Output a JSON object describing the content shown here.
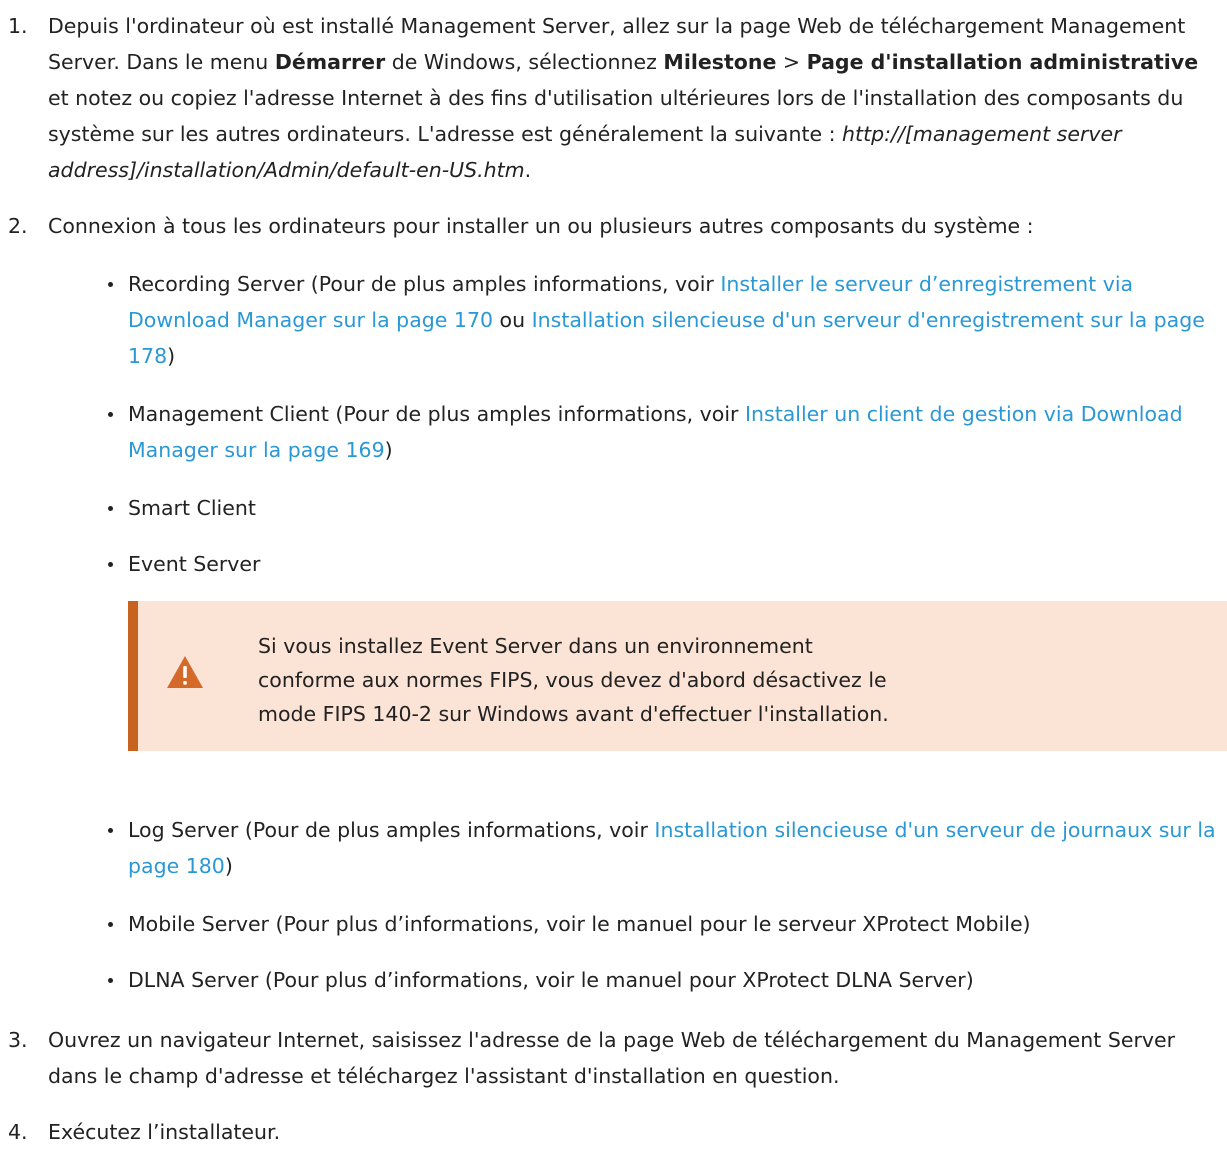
{
  "steps": [
    {
      "number": "1.",
      "text_a": "Depuis l'ordinateur où est installé Management Server, allez sur la page Web de téléchargement Management Server. Dans le menu ",
      "bold_a": "Démarrer",
      "text_b": " de Windows, sélectionnez ",
      "bold_b": "Milestone",
      "text_c": " > ",
      "bold_c": "Page d'installation administrative",
      "text_d": " et notez ou copiez l'adresse Internet à des fins d'utilisation ultérieures lors de l'installation des composants du système sur les autres ordinateurs. L'adresse est généralement la suivante : ",
      "italic": "http://[management server address]/installation/Admin/default-en-US.htm",
      "text_e": "."
    },
    {
      "number": "2.",
      "text": "Connexion à tous les ordinateurs pour installer un ou plusieurs autres composants du système :"
    },
    {
      "number": "3.",
      "text": "Ouvrez un navigateur Internet, saisissez l'adresse de la page Web de téléchargement du Management Server dans le champ d'adresse et téléchargez l'assistant d'installation en question."
    },
    {
      "number": "4.",
      "text": "Exécutez l’installateur."
    }
  ],
  "components": {
    "recording": {
      "text": "Recording Server (Pour de plus amples informations, voir ",
      "link1": "Installer le serveur d’enregistrement via Download Manager sur la page 170",
      "middle": " ou ",
      "link2": "Installation silencieuse d'un serveur d'enregistrement sur la page 178",
      "end": ")"
    },
    "management": {
      "text": "Management Client (Pour de plus amples informations, voir ",
      "link": "Installer un client de gestion via Download Manager sur la page 169",
      "end": ")"
    },
    "smart_client": "Smart Client",
    "event_server": "Event Server",
    "log_server": {
      "text": "Log Server (Pour de plus amples informations, voir ",
      "link": "Installation silencieuse d'un serveur de journaux sur la page 180",
      "end": ")"
    },
    "mobile_server": "Mobile Server  (Pour plus d’informations, voir le manuel pour le serveur XProtect Mobile)",
    "dlna_server": "DLNA Server  (Pour plus d’informations, voir le manuel pour XProtect DLNA Server)"
  },
  "note": {
    "text": "Si vous installez Event Server dans un environnement conforme aux normes FIPS, vous devez d'abord désactivez le mode FIPS 140-2 sur Windows avant d'effectuer l'installation.",
    "icon": "warning-icon",
    "border_color": "#c8631f",
    "background_color": "#fbe3d6"
  },
  "colors": {
    "link": "#2a98d4",
    "text": "#222222"
  }
}
